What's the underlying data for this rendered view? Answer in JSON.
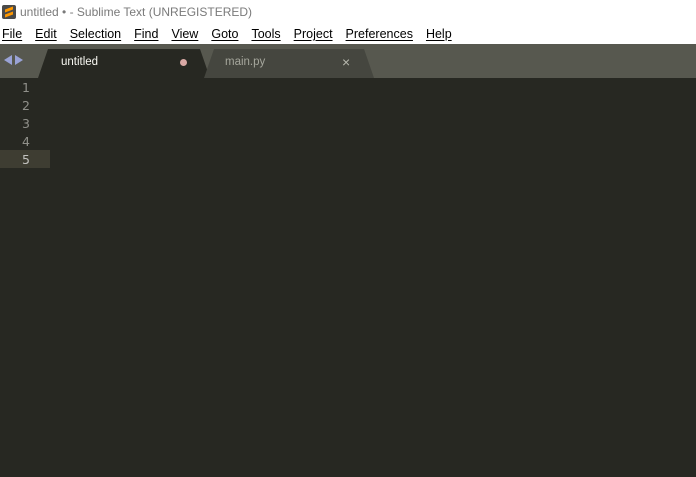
{
  "window": {
    "title": "untitled • - Sublime Text (UNREGISTERED)"
  },
  "menu": {
    "items": [
      "File",
      "Edit",
      "Selection",
      "Find",
      "View",
      "Goto",
      "Tools",
      "Project",
      "Preferences",
      "Help"
    ]
  },
  "tabs": [
    {
      "label": "untitled",
      "active": true,
      "modified": true
    },
    {
      "label": "main.py",
      "active": false,
      "modified": false
    }
  ],
  "editor": {
    "line_numbers": [
      "1",
      "2",
      "3",
      "4",
      "5"
    ],
    "current_line": 5
  },
  "colors": {
    "editor_bg": "#272822",
    "tabbar_bg": "#57584f",
    "current_line_bg": "#3e3d32",
    "line_number": "#90908a"
  }
}
